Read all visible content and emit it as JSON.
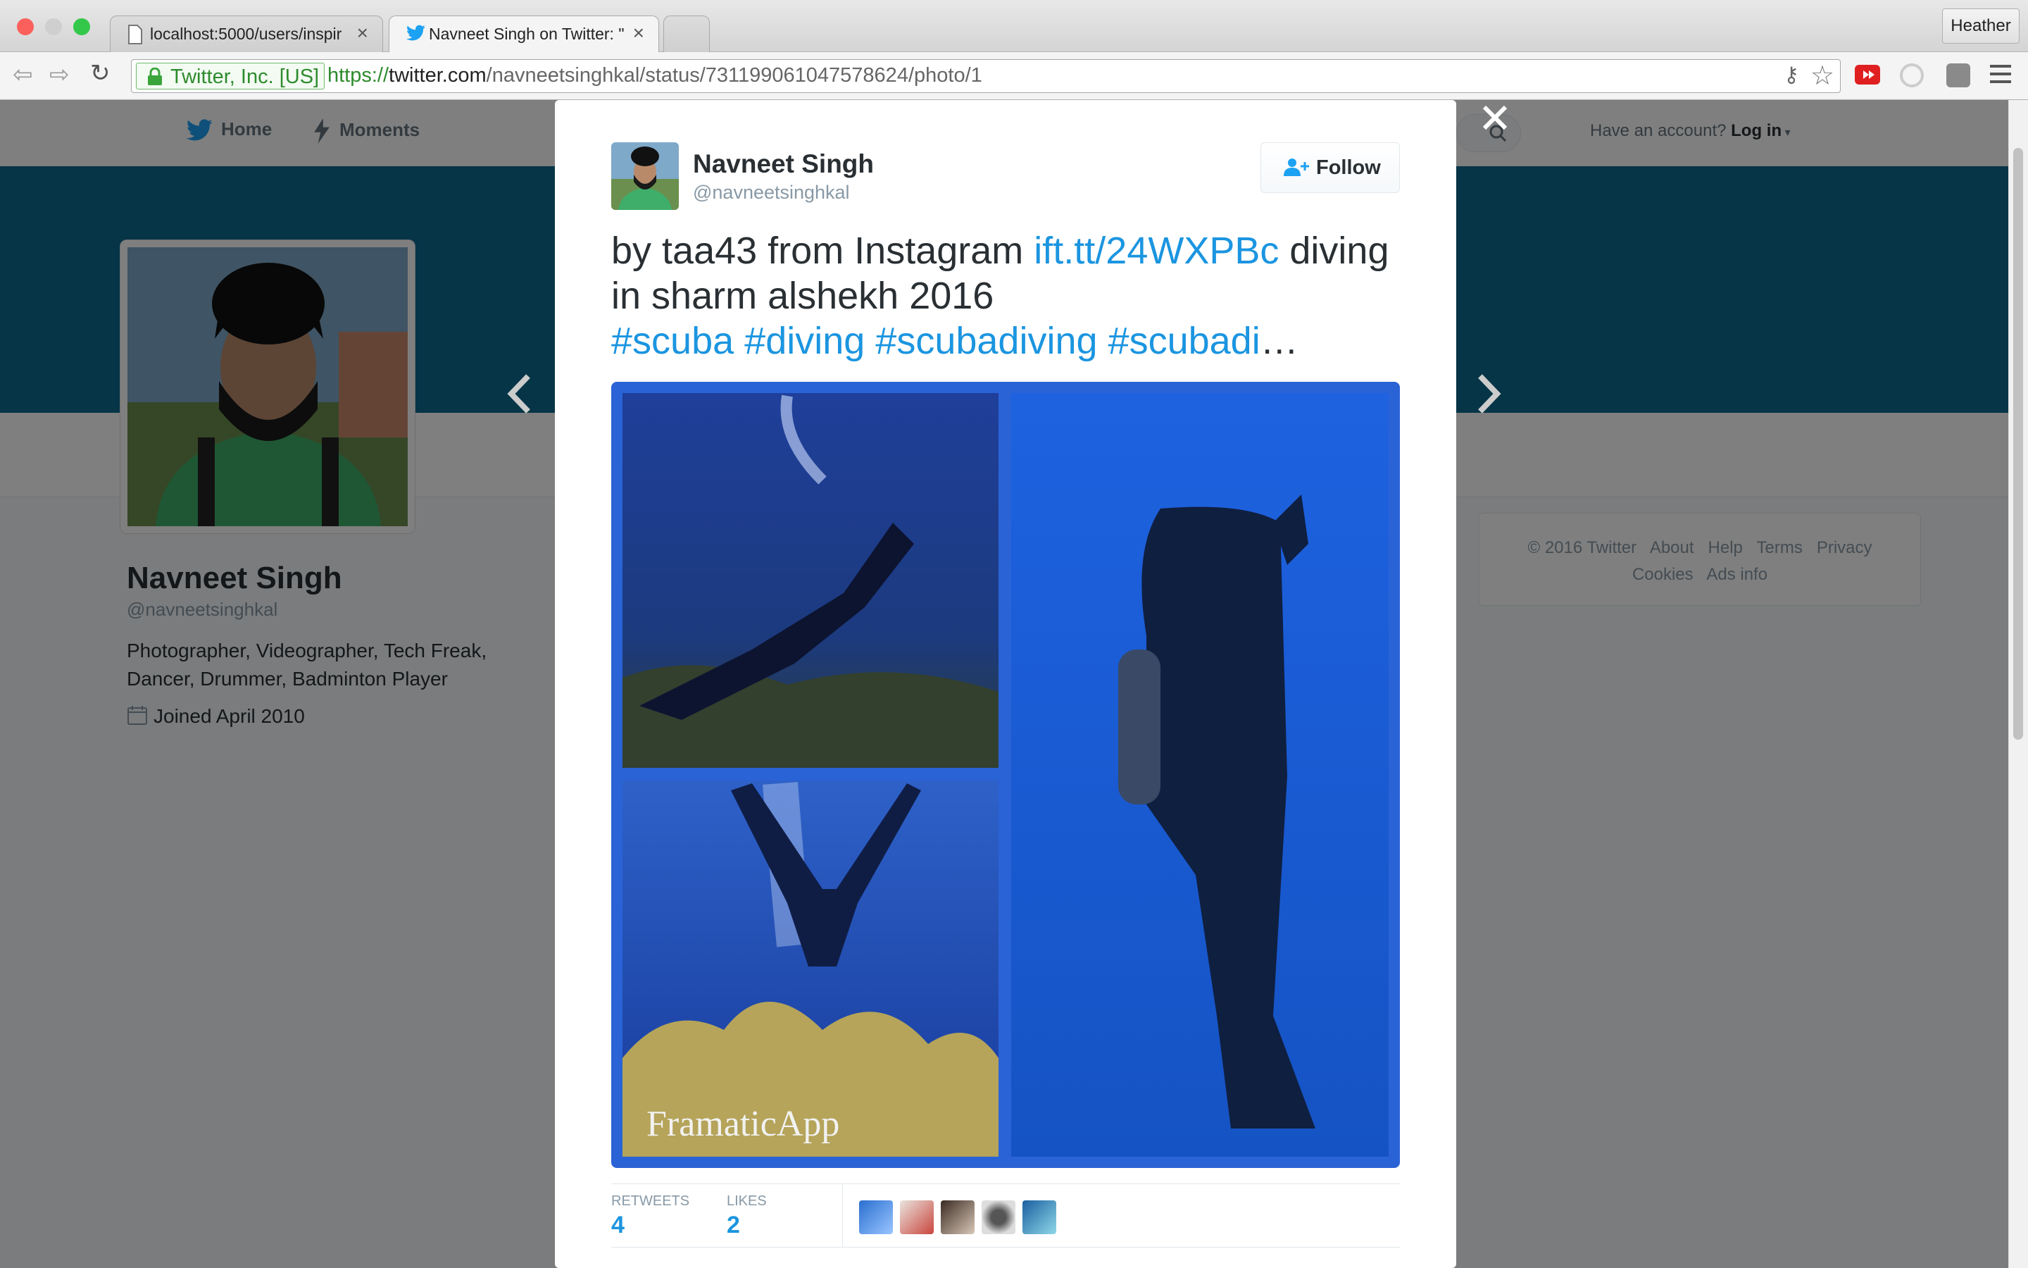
{
  "browser": {
    "tabs": [
      {
        "title": "localhost:5000/users/inspir"
      },
      {
        "title": "Navneet Singh on Twitter: \""
      }
    ],
    "profile_name": "Heather",
    "security_label": "Twitter, Inc. [US]",
    "url_scheme": "https://",
    "url_host": "twitter.com",
    "url_path": "/navneetsinghkal/status/731199061047578624/photo/1"
  },
  "twitter_nav": {
    "home_label": "Home",
    "moments_label": "Moments",
    "have_account": "Have an account?",
    "login_label": "Log in"
  },
  "profile": {
    "name": "Navneet Singh",
    "handle": "@navneetsinghkal",
    "bio_line1": "Photographer, Videographer, Tech Freak,",
    "bio_line2": "Dancer, Drummer, Badminton Player",
    "joined": "Joined April 2010"
  },
  "footer": {
    "copyright": "© 2016 Twitter",
    "about": "About",
    "help": "Help",
    "terms": "Terms",
    "privacy": "Privacy",
    "cookies": "Cookies",
    "ads_info": "Ads info"
  },
  "tweet": {
    "author_name": "Navneet Singh",
    "author_handle": "@navneetsinghkal",
    "follow_label": "Follow",
    "text_part1": "by taa43 from Instagram ",
    "link": "ift.tt/24WXPBc",
    "text_part2": " diving in sharm alshekh 2016",
    "hashtags": [
      "#scuba",
      "#diving",
      "#scubadiving",
      "#scubadi"
    ],
    "ellipsis": "…",
    "watermark": "FramaticApp",
    "retweets_label": "RETWEETS",
    "retweets_count": "4",
    "likes_label": "LIKES",
    "likes_count": "2"
  },
  "colors": {
    "twitter_blue": "#1b95e0",
    "banner": "#0b6b8e",
    "ocean": "#1a4fc4"
  },
  "icons": [
    "twitter-bird-icon",
    "lightning-icon",
    "search-icon",
    "close-icon",
    "chevron-left-icon",
    "chevron-right-icon",
    "follow-person-icon",
    "calendar-icon",
    "lock-icon",
    "star-icon",
    "key-icon",
    "menu-icon"
  ]
}
